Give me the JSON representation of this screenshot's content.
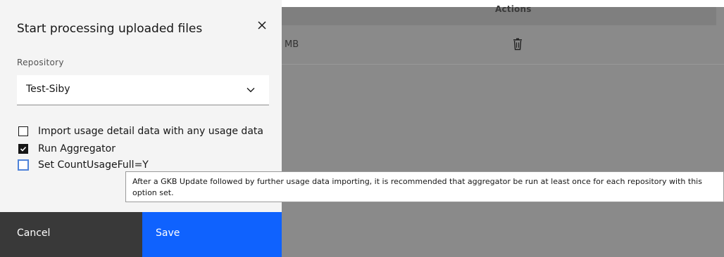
{
  "background": {
    "column_header": "Actions",
    "row_size_fragment": "MB",
    "row_action_icon": "trash-icon"
  },
  "modal": {
    "title": "Start processing uploaded files",
    "close_icon": "close-icon",
    "repository_label": "Repository",
    "repository_value": "Test-Siby",
    "options": [
      {
        "label": "Import usage detail data with any usage data",
        "checked": false
      },
      {
        "label": "Run Aggregator",
        "checked": true
      },
      {
        "label": "Set CountUsageFull=Y",
        "checked": false
      }
    ],
    "tooltip": "After a GKB Update followed by further usage data importing, it is recommended that aggregator be run at least once for each repository with this option set.",
    "cancel_label": "Cancel",
    "save_label": "Save"
  },
  "colors": {
    "primary": "#0f62fe",
    "secondary": "#393939",
    "overlay": "#8a8a8a",
    "focus": "#4f83d9"
  }
}
